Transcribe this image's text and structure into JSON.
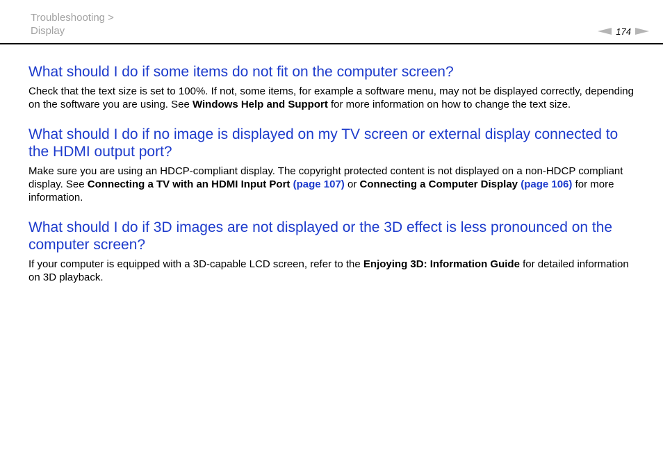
{
  "breadcrumb": {
    "parent": "Troubleshooting >",
    "current": "Display"
  },
  "pager": {
    "page_number": "174"
  },
  "sections": [
    {
      "heading": "What should I do if some items do not fit on the computer screen?",
      "text_1": "Check that the text size is set to 100%. If not, some items, for example a software menu, may not be displayed correctly, depending on the software you are using. See ",
      "bold_1": "Windows Help and Support",
      "text_2": " for more information on how to change the text size."
    },
    {
      "heading": "What should I do if no image is displayed on my TV screen or external display connected to the HDMI output port?",
      "text_1": "Make sure you are using an HDCP-compliant display. The copyright protected content is not displayed on a non-HDCP compliant display. See ",
      "bold_1": "Connecting a TV with an HDMI Input Port",
      "link_1": "(page 107)",
      "text_2": " or ",
      "bold_2": "Connecting a Computer Display",
      "link_2": "(page 106)",
      "text_3": " for more information."
    },
    {
      "heading": "What should I do if 3D images are not displayed or the 3D effect is less pronounced on the computer screen?",
      "text_1": "If your computer is equipped with a 3D-capable LCD screen, refer to the ",
      "bold_1": "Enjoying 3D: Information Guide",
      "text_2": " for detailed information on 3D playback."
    }
  ],
  "colors": {
    "heading": "#1d3bcc",
    "breadcrumb": "#a3a3a3",
    "pager_arrow": "#b5b5b5"
  },
  "icons": {
    "prev": "arrow-left-icon",
    "next": "arrow-right-icon"
  }
}
